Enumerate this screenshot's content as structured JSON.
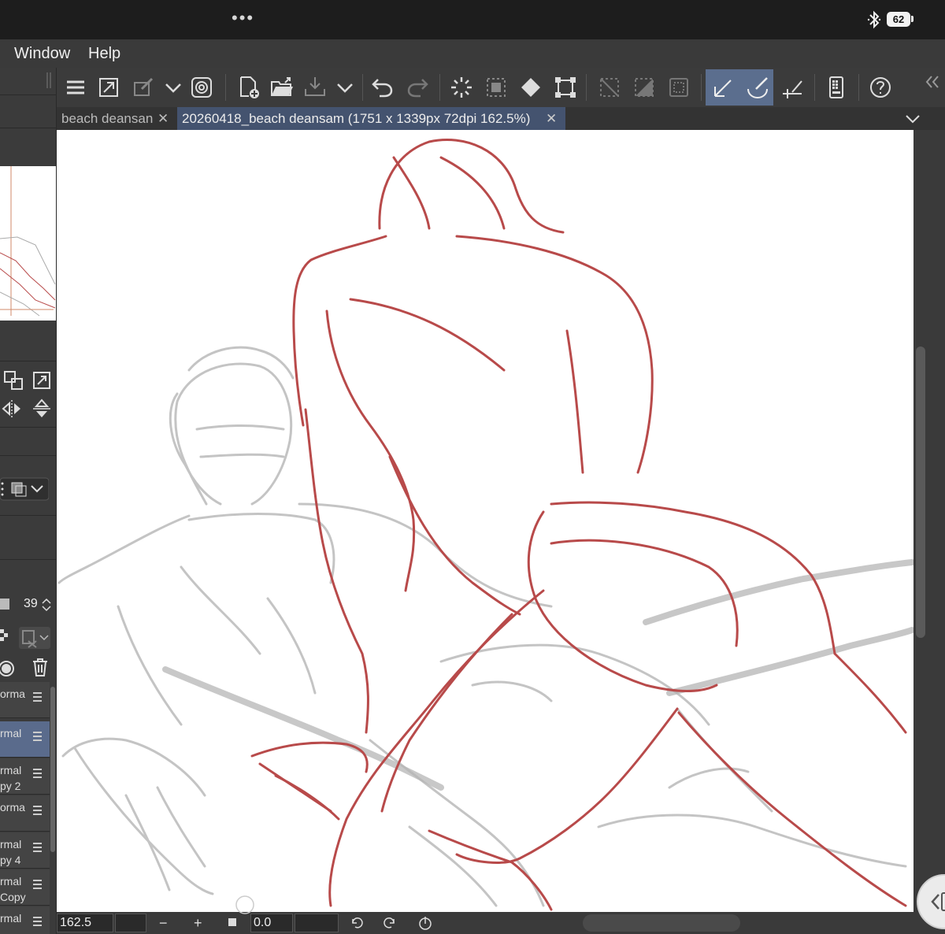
{
  "status_bar": {
    "multitask_dots": "•••",
    "bluetooth_icon": "bluetooth-icon",
    "battery_level": "62"
  },
  "menu": {
    "items": [
      {
        "label": "Window"
      },
      {
        "label": "Help"
      }
    ]
  },
  "tabs": [
    {
      "label": "beach deansan",
      "close": "✕"
    },
    {
      "label": "20260418_beach deansam (1751 x 1339px 72dpi 162.5%)",
      "close": "✕"
    }
  ],
  "toolbar": {
    "icons": [
      "menu-icon",
      "fullscreen-icon",
      "smart-paint-icon",
      "chevron-down-icon",
      "quick-access-icon",
      "new-canvas-icon",
      "open-folder-icon",
      "save-icon",
      "chevron-down-icon",
      "undo-icon",
      "redo-icon",
      "clear-selection-icon",
      "select-all-icon",
      "fill-icon",
      "transform-icon",
      "deselect-icon",
      "invert-selection-icon",
      "selection-border-icon",
      "snap-ruler-icon",
      "snap-special-ruler-icon",
      "snap-grid-icon",
      "companion-mode-icon",
      "help-icon"
    ],
    "active_tools": [
      "snap-ruler-icon",
      "snap-special-ruler-icon"
    ]
  },
  "left_panel": {
    "brush_size": "39",
    "layers": [
      {
        "label": "orma",
        "selected": false
      },
      {
        "label": "rmal",
        "selected": true
      },
      {
        "label": "rmal\npy 2",
        "selected": false
      },
      {
        "label": "orma",
        "selected": false
      },
      {
        "label": "rmal\npy 4",
        "selected": false
      },
      {
        "label": "rmal\nCopy",
        "selected": false
      },
      {
        "label": "rmal",
        "selected": false
      }
    ]
  },
  "bottom_bar": {
    "zoom_value": "162.5",
    "rotation_value": "0.0",
    "zoom_out": "−",
    "zoom_in": "+"
  },
  "colors": {
    "sketch_red": "#b84a4a",
    "sketch_gray": "#bdbdbd",
    "active_blue": "#5b6e8e"
  }
}
